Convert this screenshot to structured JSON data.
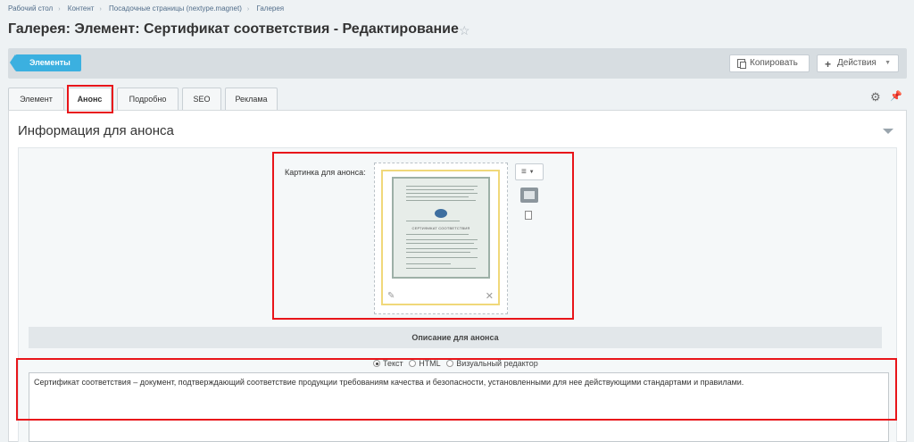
{
  "breadcrumbs": [
    "Рабочий стол",
    "Контент",
    "Посадочные страницы (nextype.magnet)",
    "Галерея"
  ],
  "page": {
    "title": "Галерея: Элемент: Сертификат соответствия - Редактирование"
  },
  "toolbar": {
    "elements_label": "Элементы",
    "copy_label": "Копировать",
    "actions_label": "Действия"
  },
  "tabs": [
    {
      "label": "Элемент"
    },
    {
      "label": "Анонс",
      "active": true
    },
    {
      "label": "Подробно"
    },
    {
      "label": "SEO"
    },
    {
      "label": "Реклама"
    }
  ],
  "section": {
    "title": "Информация для анонса",
    "image_label": "Картинка для анонса:",
    "description_header": "Описание для анонса",
    "text_modes": [
      "Текст",
      "HTML",
      "Визуальный редактор"
    ],
    "selected_mode": "Текст",
    "description_text": "Сертификат соответствия – документ, подтверждающий соответствие продукции требованиям качества и безопасности, установленными для нее действующими стандартами и правилами."
  },
  "certificate": {
    "heading": "СЕРТИФИКАТ СООТВЕТСТВИЯ"
  },
  "icons": {
    "star": "star-icon",
    "copy": "copy-icon",
    "plus": "plus-icon",
    "gear": "gear-icon",
    "pin": "pin-icon",
    "edit": "pencil-icon",
    "delete": "close-icon",
    "image": "image-icon",
    "file": "file-icon"
  },
  "colors": {
    "accent": "#3bb0e0",
    "highlight": "#e8151a"
  }
}
